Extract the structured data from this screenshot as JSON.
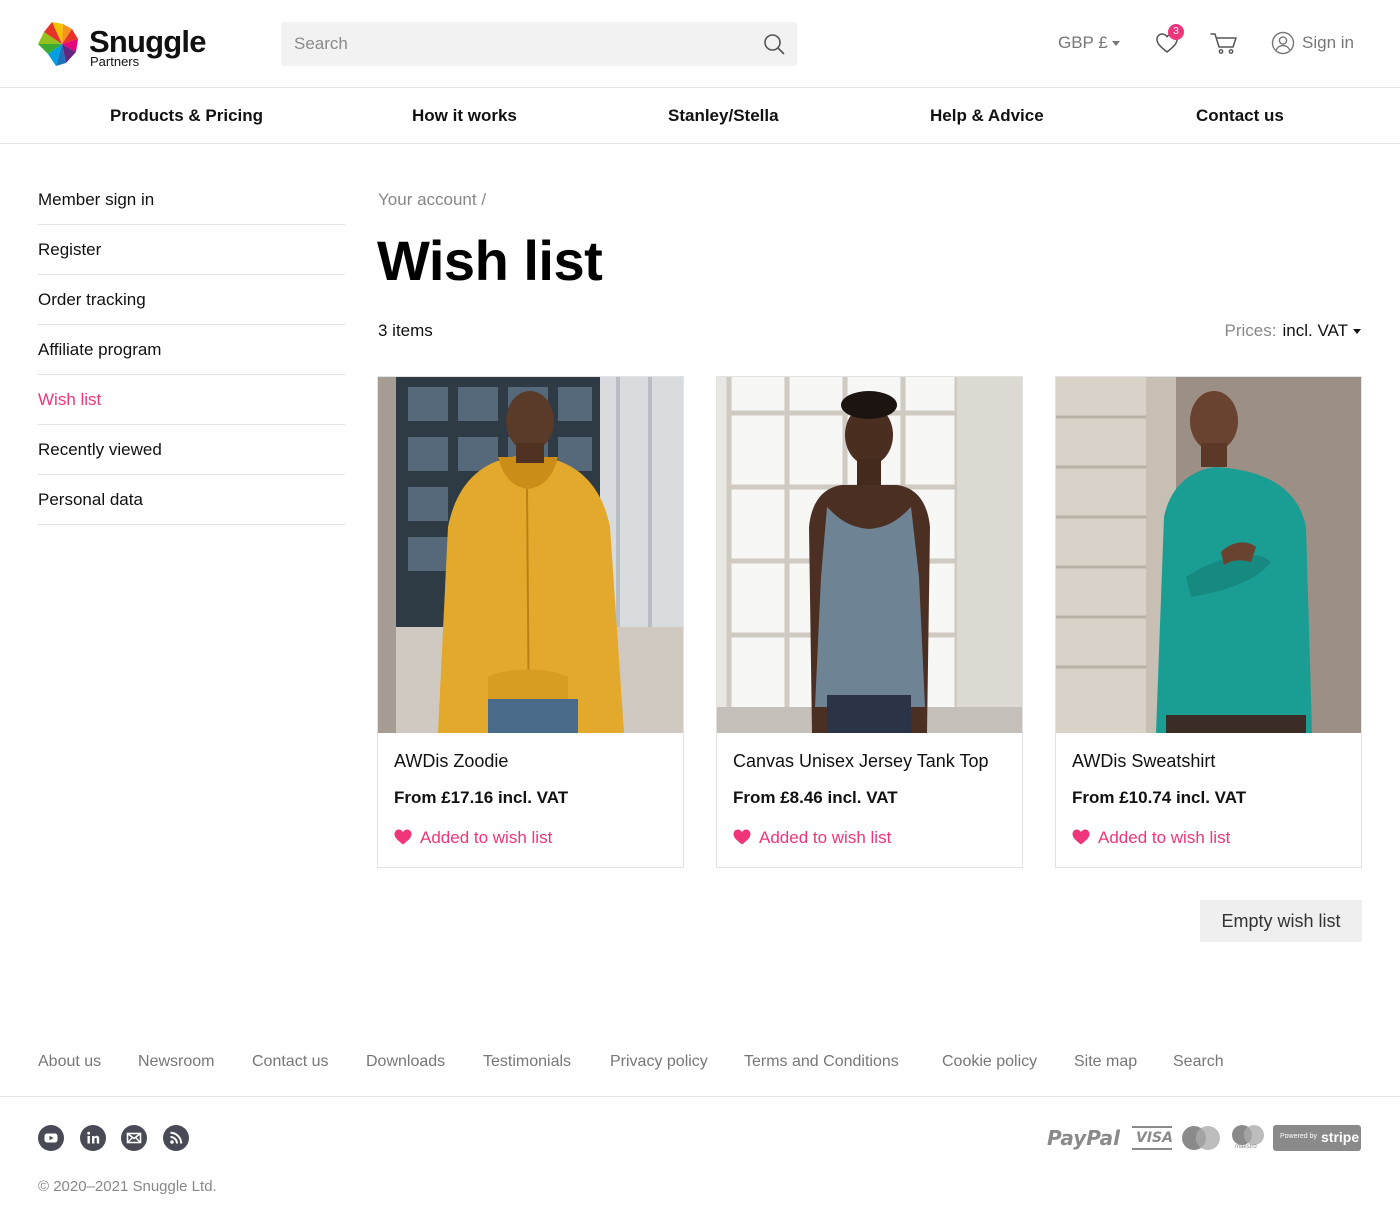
{
  "header": {
    "logo_word": "Snuggle",
    "logo_sub": "Partners",
    "search_placeholder": "Search",
    "currency": "GBP £",
    "wishlist_count": "3",
    "signin_label": "Sign in"
  },
  "nav": {
    "items": [
      "Products & Pricing",
      "How it works",
      "Stanley/Stella",
      "Help & Advice",
      "Contact us"
    ]
  },
  "sidebar": {
    "items": [
      "Member sign in",
      "Register",
      "Order tracking",
      "Affiliate program",
      "Wish list",
      "Recently viewed",
      "Personal data"
    ],
    "active": "Wish list"
  },
  "main": {
    "breadcrumb": "Your account /",
    "title": "Wish list",
    "count": "3 items",
    "prices_label": "Prices:",
    "prices_value": "incl. VAT",
    "products": [
      {
        "name": "AWDis Zoodie",
        "price": "From £17.16 incl. VAT",
        "status": "Added to wish list",
        "garment_color": "#e3a92c"
      },
      {
        "name": "Canvas Unisex Jersey Tank Top",
        "price": "From £8.46 incl. VAT",
        "status": "Added to wish list",
        "garment_color": "#6e8495"
      },
      {
        "name": "AWDis Sweatshirt",
        "price": "From £10.74 incl. VAT",
        "status": "Added to wish list",
        "garment_color": "#1a9e94"
      }
    ],
    "empty_label": "Empty wish list"
  },
  "footer": {
    "links": [
      "About us",
      "Newsroom",
      "Contact us",
      "Downloads",
      "Testimonials",
      "Privacy policy",
      "Terms and Conditions",
      "Cookie policy",
      "Site map",
      "Search"
    ],
    "social_icons": [
      "youtube-icon",
      "linkedin-icon",
      "email-icon",
      "rss-icon"
    ],
    "payments": {
      "paypal": "PayPal",
      "visa": "VISA",
      "maestro": "maestro",
      "stripe_prefix": "Powered by",
      "stripe": "stripe"
    },
    "copyright": "© 2020–2021 Snuggle Ltd."
  },
  "colors": {
    "accent": "#f0357a",
    "muted": "#777777",
    "divider": "#e3e3e3"
  }
}
